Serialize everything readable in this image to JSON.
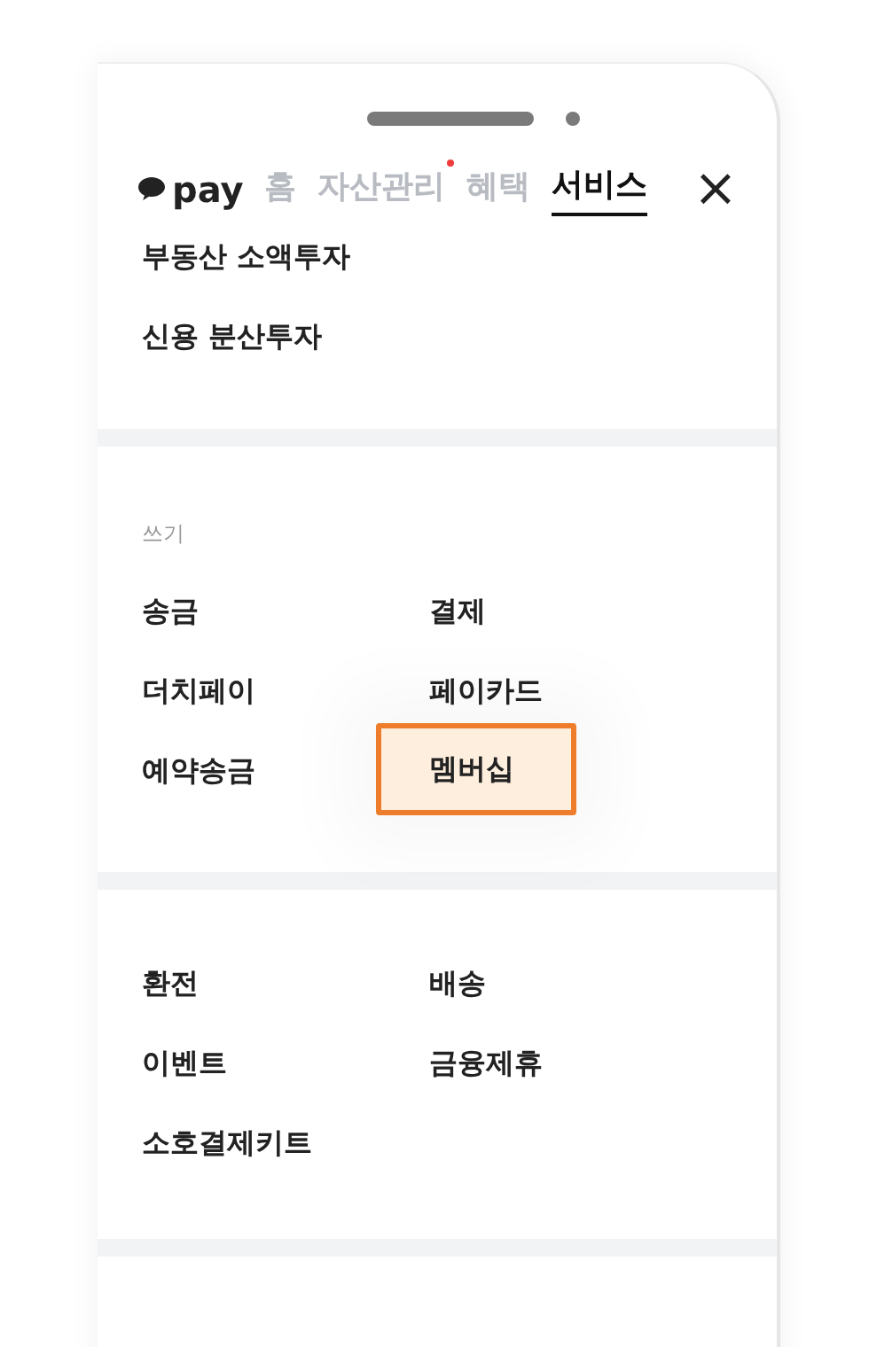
{
  "header": {
    "logo": "pay",
    "tabs": [
      {
        "label": "홈",
        "selected": false,
        "dot": false
      },
      {
        "label": "자산관리",
        "selected": false,
        "dot": true
      },
      {
        "label": "혜택",
        "selected": false,
        "dot": false
      },
      {
        "label": "서비스",
        "selected": true,
        "dot": false
      }
    ],
    "close": "×"
  },
  "sections": [
    {
      "items": [
        {
          "label": "부동산 소액투자",
          "highlighted": false
        },
        {
          "label": "신용 분산투자",
          "highlighted": false
        }
      ],
      "kind": "list"
    },
    {
      "heading": "쓰기",
      "kind": "grid",
      "items": [
        {
          "label": "송금",
          "highlighted": false
        },
        {
          "label": "결제",
          "highlighted": false
        },
        {
          "label": "더치페이",
          "highlighted": false
        },
        {
          "label": "페이카드",
          "highlighted": false
        },
        {
          "label": "예약송금",
          "highlighted": false
        },
        {
          "label": "멤버십",
          "highlighted": true
        }
      ]
    },
    {
      "kind": "grid",
      "items": [
        {
          "label": "환전",
          "highlighted": false
        },
        {
          "label": "배송",
          "highlighted": false
        },
        {
          "label": "이벤트",
          "highlighted": false
        },
        {
          "label": "금융제휴",
          "highlighted": false
        },
        {
          "label": "소호결제키트",
          "highlighted": false
        }
      ]
    }
  ]
}
